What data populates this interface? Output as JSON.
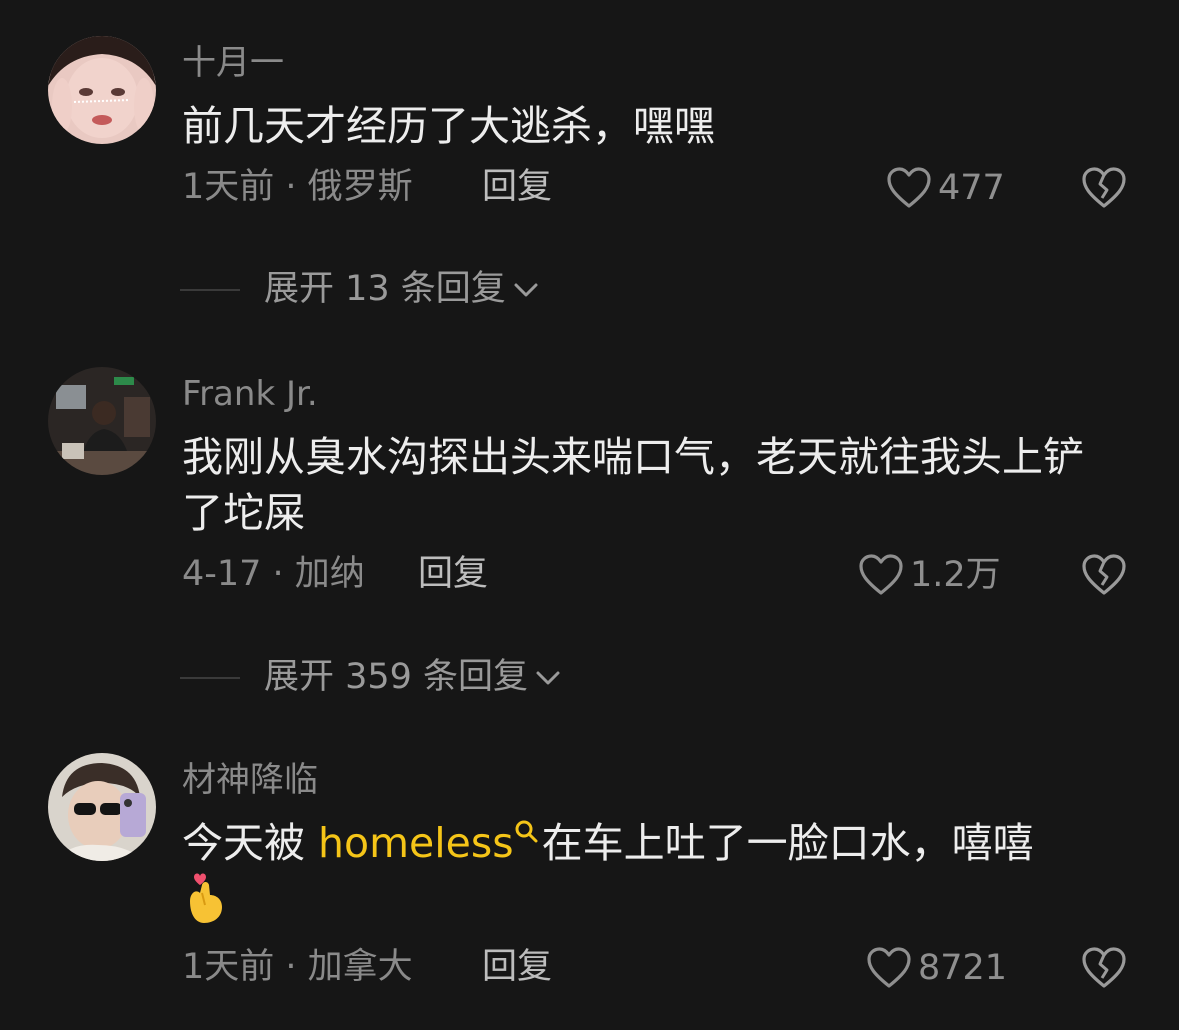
{
  "comments": [
    {
      "username": "十月一",
      "text": "前几天才经历了大逃杀，嘿嘿",
      "meta": "1天前 · 俄罗斯",
      "reply_label": "回复",
      "likes": "477",
      "expand_label": "展开 13 条回复"
    },
    {
      "username": "Frank Jr.",
      "text": "我刚从臭水沟探出头来喘口气，老天就往我头上铲了坨屎",
      "meta": "4-17 · 加纳",
      "reply_label": "回复",
      "likes": "1.2万",
      "expand_label": "展开 359 条回复"
    },
    {
      "username": "材神降临",
      "text_before": "今天被 ",
      "highlight": "homeless",
      "text_after": "在车上吐了一脸口水，嘻嘻",
      "emoji": "heart-hands",
      "meta": "1天前 · 加拿大",
      "reply_label": "回复",
      "likes": "8721"
    }
  ],
  "colors": {
    "background": "#161616",
    "highlight": "#f5c518",
    "secondary_text": "#8a8a8a"
  },
  "icons": [
    "heart-outline-icon",
    "broken-heart-icon",
    "chevron-down-icon",
    "search-icon"
  ]
}
